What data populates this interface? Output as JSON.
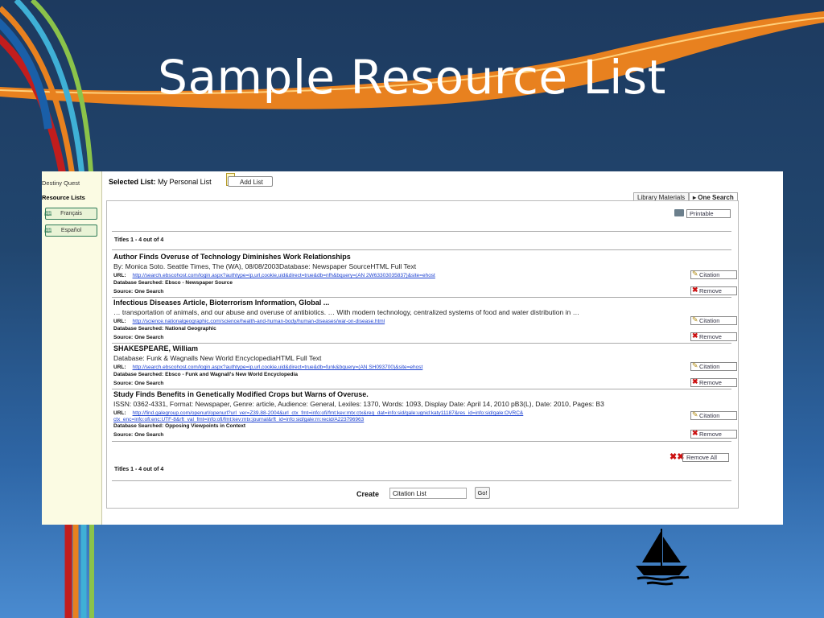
{
  "slide": {
    "title": "Sample Resource List"
  },
  "colors": {
    "background": "#21466f",
    "swoosh_orange": "#e07a1a",
    "link": "#1a3fd0",
    "remove_red": "#cc1111"
  },
  "sidebar": {
    "items": [
      {
        "label": "Destiny Quest"
      },
      {
        "label": "Resource Lists"
      }
    ],
    "languages": [
      {
        "label": "Français",
        "icon": "book-icon"
      },
      {
        "label": "Español",
        "icon": "book-icon"
      }
    ]
  },
  "header": {
    "selected_list_label": "Selected List:",
    "selected_list_value": "My Personal List",
    "add_list_button": "Add List"
  },
  "tabs": [
    {
      "label": "Library Materials",
      "active": false
    },
    {
      "label": "One Search",
      "active": true
    }
  ],
  "toolbar": {
    "printable": "Printable"
  },
  "summary": {
    "top": "Titles 1 - 4 out of 4",
    "bottom": "Titles 1 - 4 out of 4"
  },
  "labels": {
    "url": "URL:",
    "database": "Database Searched:",
    "source": "Source:",
    "citation": "Citation",
    "remove": "Remove",
    "remove_all": "Remove All"
  },
  "results": [
    {
      "title": "Author Finds Overuse of Technology Diminishes Work Relationships",
      "description": "By: Monica Soto. Seattle Times, The (WA), 08/08/2003Database: Newspaper SourceHTML Full Text",
      "url": "http://search.ebscohost.com/login.aspx?authtype=ip,url,cookie,uid&direct=true&db=nfh&bquery=(AN 2W63303035837)&site=ehost",
      "database": "Ebsco - Newspaper Source",
      "source": "One Search"
    },
    {
      "title": "Infectious Diseases Article, Bioterrorism Information, Global ...",
      "description": "… transportation of animals, and our abuse and overuse of antibiotics. … With modern technology, centralized systems of food and water distribution in …",
      "url": "http://science.nationalgeographic.com/science/health-and-human-body/human-diseases/war-on-disease.html",
      "database": "National Geographic",
      "source": "One Search"
    },
    {
      "title": "SHAKESPEARE, William",
      "description": "Database: Funk & Wagnalls New World EncyclopediaHTML Full Text",
      "url": "http://search.ebscohost.com/login.aspx?authtype=ip,url,cookie,uid&direct=true&db=funk&bquery=(AN SH093700)&site=ehost",
      "database": "Ebsco - Funk and Wagnall's New World Encyclopedia",
      "source": "One Search"
    },
    {
      "title": "Study Finds Benefits in Genetically Modified Crops but Warns of Overuse.",
      "description": "ISSN: 0362-4331, Format: Newspaper, Genre: article, Audience: General, Lexiles: 1370, Words: 1093, Display Date: April 14, 2010 pB3(L), Date: 2010, Pages: B3",
      "url": "http://find.galegroup.com/openurl/openurl?url_ver=Z39.88-2004&url_ctx_fmt=info:ofi/fmt:kev:mtx:ctx&req_dat=info:sid/gale:ugnid:katy11187&res_id=info:sid/gale:OVRC&",
      "url_line2": "ctx_enc=info:ofi:enc:UTF-8&rft_val_fmt=info:ofi/fmt:kev:mtx:journal&rft_id=info:sid/gale:rn:recid/A223796963",
      "database": "Opposing Viewpoints in Context",
      "source": "One Search"
    }
  ],
  "create": {
    "label": "Create",
    "value": "Citation List",
    "go_button": "Go!"
  },
  "decor": {
    "logo_icon": "sailboat-icon"
  }
}
